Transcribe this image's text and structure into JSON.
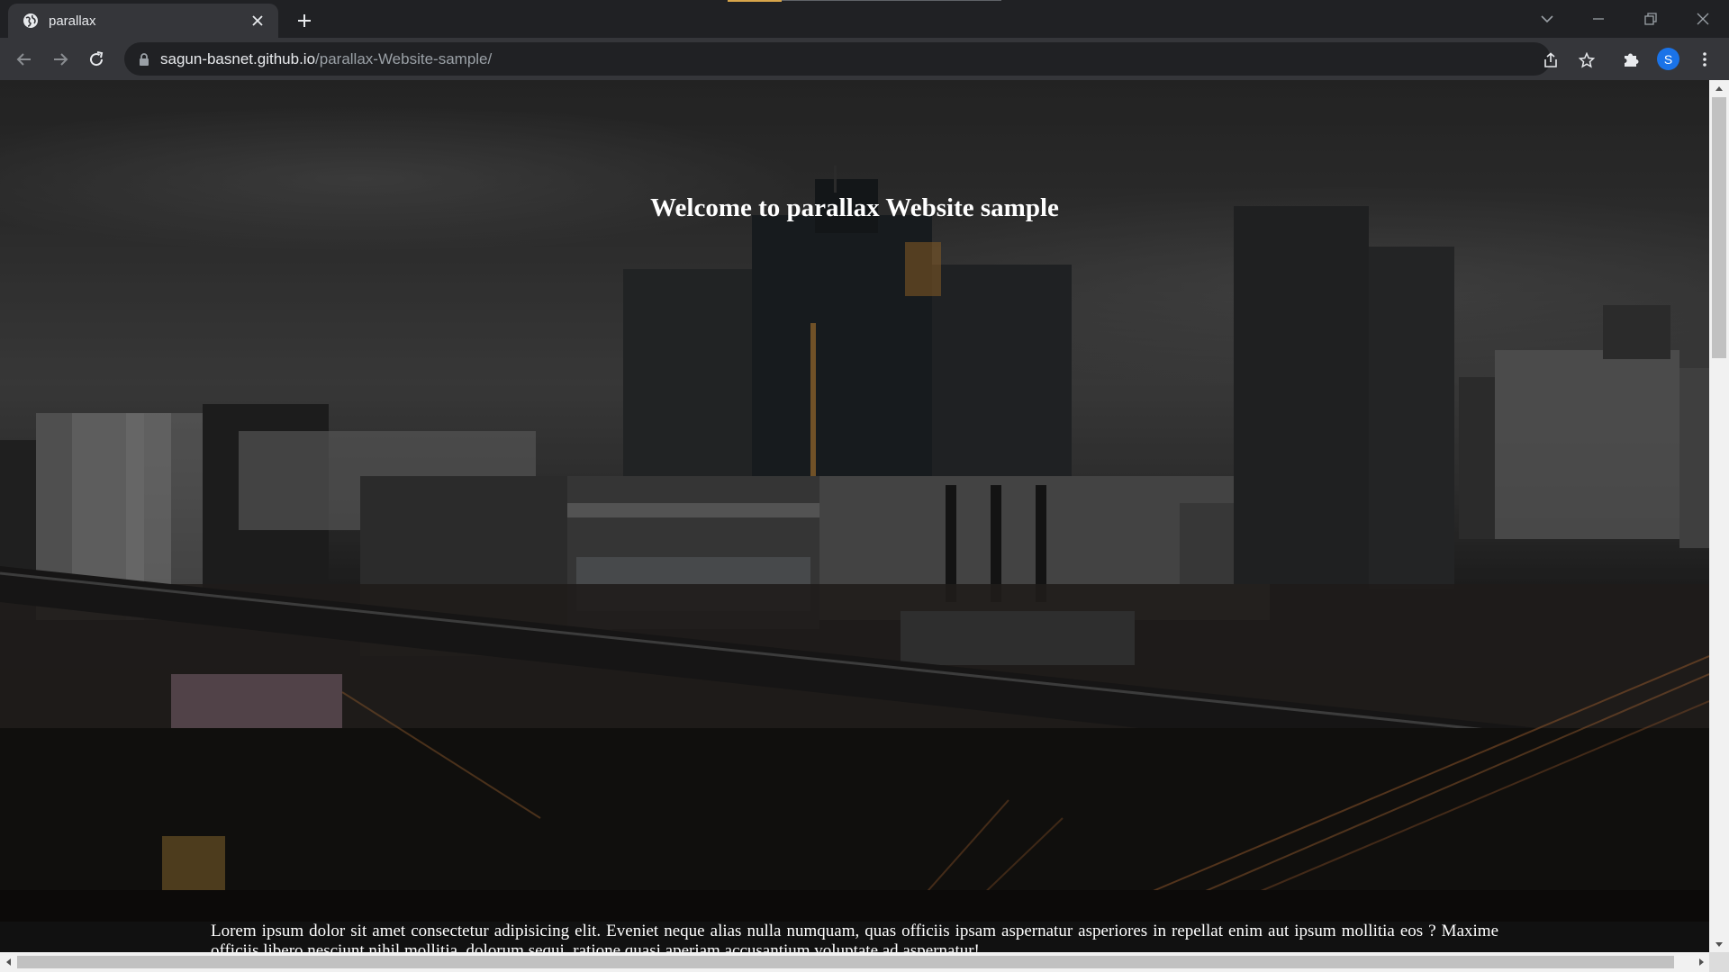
{
  "browser": {
    "tab": {
      "title": "parallax",
      "favicon": "globe-icon"
    },
    "url_host": "sagun-basnet.github.io",
    "url_path": "/parallax-Website-sample/",
    "profile_initial": "S",
    "colors": {
      "chrome_dark": "#202124",
      "chrome_light": "#35363a",
      "avatar": "#1a73e8",
      "loading": "#d7a54a"
    }
  },
  "page": {
    "hero_title": "Welcome to parallax Website sample",
    "body_text": "Lorem ipsum dolor sit amet consectetur adipisicing elit. Eveniet neque alias nulla numquam, quas officiis ipsam aspernatur asperiores in repellat enim aut ipsum mollitia eos ? Maxime officiis libero nesciunt nihil mollitia, dolorum sequi, ratione quasi aperiam accusantium voluptate ad aspernatur!",
    "background": "city-skyline-photo"
  }
}
